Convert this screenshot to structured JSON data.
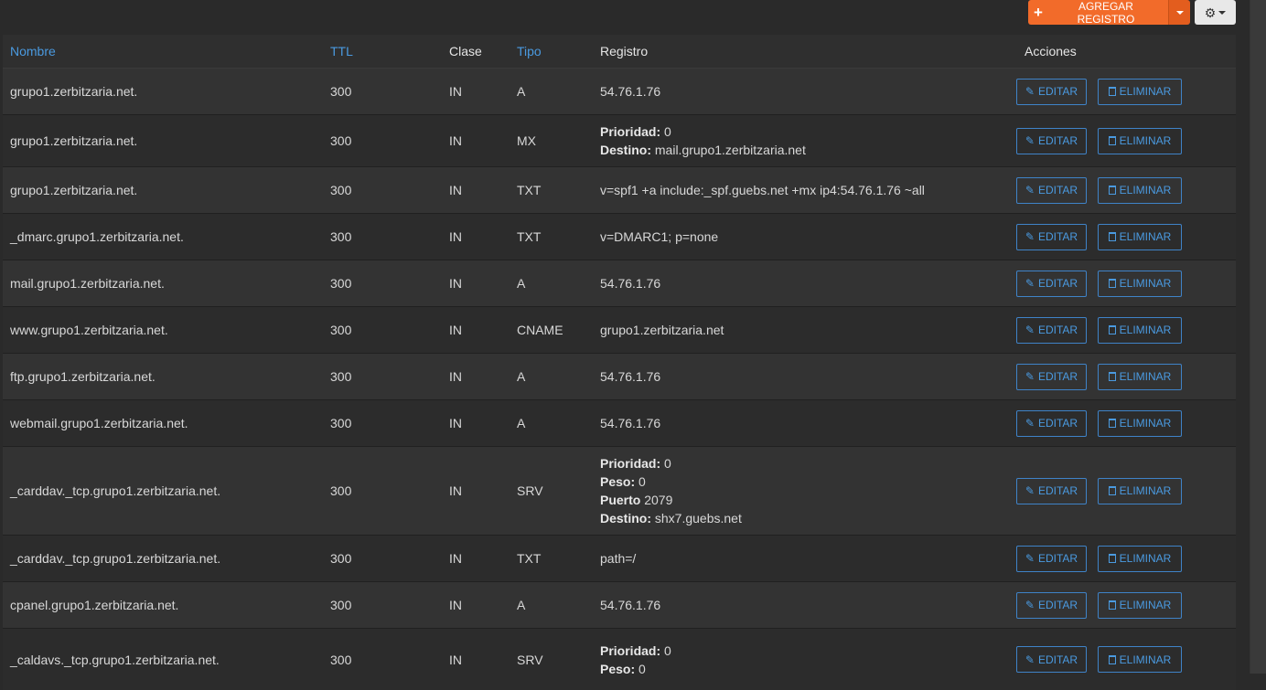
{
  "toolbar": {
    "add_label": "AGREGAR REGISTRO"
  },
  "table": {
    "headers": {
      "name": "Nombre",
      "ttl": "TTL",
      "class": "Clase",
      "type": "Tipo",
      "record": "Registro",
      "actions": "Acciones"
    },
    "edit_label": "EDITAR",
    "delete_label": "ELIMINAR",
    "rows": [
      {
        "name": "grupo1.zerbitzaria.net.",
        "ttl": "300",
        "class": "IN",
        "type": "A",
        "record": [
          {
            "t": "54.76.1.76"
          }
        ]
      },
      {
        "name": "grupo1.zerbitzaria.net.",
        "ttl": "300",
        "class": "IN",
        "type": "MX",
        "record": [
          {
            "k": "Prioridad:",
            "t": " 0"
          },
          {
            "k": "Destino:",
            "t": " mail.grupo1.zerbitzaria.net"
          }
        ]
      },
      {
        "name": "grupo1.zerbitzaria.net.",
        "ttl": "300",
        "class": "IN",
        "type": "TXT",
        "record": [
          {
            "t": "v=spf1 +a include:_spf.guebs.net +mx ip4:54.76.1.76 ~all"
          }
        ]
      },
      {
        "name": "_dmarc.grupo1.zerbitzaria.net.",
        "ttl": "300",
        "class": "IN",
        "type": "TXT",
        "record": [
          {
            "t": "v=DMARC1; p=none"
          }
        ]
      },
      {
        "name": "mail.grupo1.zerbitzaria.net.",
        "ttl": "300",
        "class": "IN",
        "type": "A",
        "record": [
          {
            "t": "54.76.1.76"
          }
        ]
      },
      {
        "name": "www.grupo1.zerbitzaria.net.",
        "ttl": "300",
        "class": "IN",
        "type": "CNAME",
        "record": [
          {
            "t": "grupo1.zerbitzaria.net"
          }
        ]
      },
      {
        "name": "ftp.grupo1.zerbitzaria.net.",
        "ttl": "300",
        "class": "IN",
        "type": "A",
        "record": [
          {
            "t": "54.76.1.76"
          }
        ]
      },
      {
        "name": "webmail.grupo1.zerbitzaria.net.",
        "ttl": "300",
        "class": "IN",
        "type": "A",
        "record": [
          {
            "t": "54.76.1.76"
          }
        ]
      },
      {
        "name": "_carddav._tcp.grupo1.zerbitzaria.net.",
        "ttl": "300",
        "class": "IN",
        "type": "SRV",
        "record": [
          {
            "k": "Prioridad:",
            "t": " 0"
          },
          {
            "k": "Peso:",
            "t": " 0"
          },
          {
            "k": "Puerto",
            "t": " 2079"
          },
          {
            "k": "Destino:",
            "t": " shx7.guebs.net"
          }
        ]
      },
      {
        "name": "_carddav._tcp.grupo1.zerbitzaria.net.",
        "ttl": "300",
        "class": "IN",
        "type": "TXT",
        "record": [
          {
            "t": "path=/"
          }
        ]
      },
      {
        "name": "cpanel.grupo1.zerbitzaria.net.",
        "ttl": "300",
        "class": "IN",
        "type": "A",
        "record": [
          {
            "t": "54.76.1.76"
          }
        ]
      },
      {
        "name": "_caldavs._tcp.grupo1.zerbitzaria.net.",
        "ttl": "300",
        "class": "IN",
        "type": "SRV",
        "record": [
          {
            "k": "Prioridad:",
            "t": " 0"
          },
          {
            "k": "Peso:",
            "t": " 0"
          }
        ]
      }
    ]
  }
}
